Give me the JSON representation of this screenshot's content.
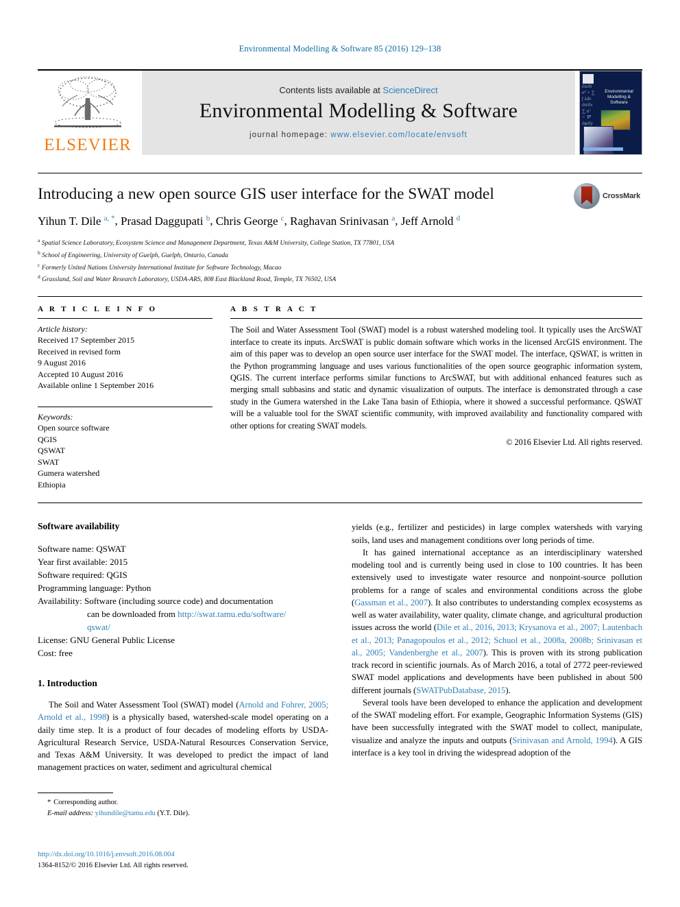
{
  "running_head": "Environmental Modelling & Software 85 (2016) 129–138",
  "masthead": {
    "publisher_name": "ELSEVIER",
    "contents_prefix": "Contents lists available at ",
    "contents_link": "ScienceDirect",
    "journal_title": "Environmental Modelling & Software",
    "homepage_prefix": "journal homepage: ",
    "homepage_url": "www.elsevier.com/locate/envsoft",
    "cover_title": "Environmental Modelling & Software",
    "link_color": "#2e7fb8",
    "panel_color": "#e4e4e4",
    "elsevier_orange": "#f07c13"
  },
  "article": {
    "title": "Introducing a new open source GIS user interface for the SWAT model",
    "crossmark_label": "CrossMark",
    "authors": [
      {
        "name": "Yihun T. Dile",
        "marks": "a, *"
      },
      {
        "name": "Prasad Daggupati",
        "marks": "b"
      },
      {
        "name": "Chris George",
        "marks": "c"
      },
      {
        "name": "Raghavan Srinivasan",
        "marks": "a"
      },
      {
        "name": "Jeff Arnold",
        "marks": "d"
      }
    ],
    "affiliations": [
      {
        "mark": "a",
        "text": "Spatial Science Laboratory, Ecosystem Science and Management Department, Texas A&M University, College Station, TX 77801, USA"
      },
      {
        "mark": "b",
        "text": "School of Engineering, University of Guelph, Guelph, Ontario, Canada"
      },
      {
        "mark": "c",
        "text": "Formerly United Nations University International Institute for Software Technology, Macao"
      },
      {
        "mark": "d",
        "text": "Grassland, Soil and Water Research Laboratory, USDA-ARS, 808 East Blackland Road, Temple, TX 76502, USA"
      }
    ]
  },
  "article_info": {
    "heading": "A R T I C L E  I N F O",
    "history_title": "Article history:",
    "history_lines": [
      "Received 17 September 2015",
      "Received in revised form",
      "9 August 2016",
      "Accepted 10 August 2016",
      "Available online 1 September 2016"
    ],
    "keywords_title": "Keywords:",
    "keywords": [
      "Open source software",
      "QGIS",
      "QSWAT",
      "SWAT",
      "Gumera watershed",
      "Ethiopia"
    ]
  },
  "abstract": {
    "heading": "A B S T R A C T",
    "text": "The Soil and Water Assessment Tool (SWAT) model is a robust watershed modeling tool. It typically uses the ArcSWAT interface to create its inputs. ArcSWAT is public domain software which works in the licensed ArcGIS environment. The aim of this paper was to develop an open source user interface for the SWAT model. The interface, QSWAT, is written in the Python programming language and uses various functionalities of the open source geographic information system, QGIS. The current interface performs similar functions to ArcSWAT, but with additional enhanced features such as merging small subbasins and static and dynamic visualization of outputs. The interface is demonstrated through a case study in the Gumera watershed in the Lake Tana basin of Ethiopia, where it showed a successful performance. QSWAT will be a valuable tool for the SWAT scientific community, with improved availability and functionality compared with other options for creating SWAT models.",
    "copyright": "© 2016 Elsevier Ltd. All rights reserved."
  },
  "software_availability": {
    "heading": "Software availability",
    "items": [
      "Software name: QSWAT",
      "Year first available: 2015",
      "Software required: QGIS",
      "Programming language: Python"
    ],
    "availability_label": "Availability: Software (including source code) and documentation",
    "availability_cont": "can be downloaded from ",
    "availability_url_1": "http://swat.tamu.edu/software/",
    "availability_url_2": "qswat/",
    "license": "License: GNU General Public License",
    "cost": "Cost: free"
  },
  "introduction": {
    "heading": "1.  Introduction",
    "p1_a": "The Soil and Water Assessment Tool (SWAT) model (",
    "p1_cite": "Arnold and Fohrer, 2005; Arnold et al., 1998",
    "p1_b": ") is a physically based, watershed-scale model operating on a daily time step. It is a product of four decades of modeling efforts by USDA-Agricultural Research Service, USDA-Natural Resources Conservation Service, and Texas A&M University. It was developed to predict the impact of land management practices on water, sediment and agricultural chemical"
  },
  "right_column": {
    "p1": "yields (e.g., fertilizer and pesticides) in large complex watersheds with varying soils, land uses and management conditions over long periods of time.",
    "p2_a": "It has gained international acceptance as an interdisciplinary watershed modeling tool and is currently being used in close to 100 countries. It has been extensively used to investigate water resource and nonpoint-source pollution problems for a range of scales and environmental conditions across the globe (",
    "p2_cite1": "Gassman et al., 2007",
    "p2_b": "). It also contributes to understanding complex ecosystems as well as water availability, water quality, climate change, and agricultural production issues across the world (",
    "p2_cite2": "Dile et al., 2016, 2013; Krysanova et al., 2007; Lautenbach et al., 2013; Panagopoulos et al., 2012; Schuol et al., 2008a, 2008b; Srinivasan et al., 2005; Vandenberghe et al., 2007",
    "p2_c": "). This is proven with its strong publication track record in scientific journals. As of March 2016, a total of 2772 peer-reviewed SWAT model applications and developments have been published in about 500 different journals (",
    "p2_cite3": "SWATPubDatabase, 2015",
    "p2_d": ").",
    "p3_a": "Several tools have been developed to enhance the application and development of the SWAT modeling effort. For example, Geographic Information Systems (GIS) have been successfully integrated with the SWAT model to collect, manipulate, visualize and analyze the inputs and outputs (",
    "p3_cite": "Srinivasan and Arnold, 1994",
    "p3_b": "). A GIS interface is a key tool in driving the widespread adoption of the"
  },
  "footnotes": {
    "corresponding_star": "*",
    "corresponding_text": "Corresponding author.",
    "email_label": "E-mail address: ",
    "email_value": "yihundile@tamu.edu",
    "email_suffix": " (Y.T. Dile)."
  },
  "doi_block": {
    "doi_url": "http://dx.doi.org/10.1016/j.envsoft.2016.08.004",
    "issn_line": "1364-8152/© 2016 Elsevier Ltd. All rights reserved."
  }
}
